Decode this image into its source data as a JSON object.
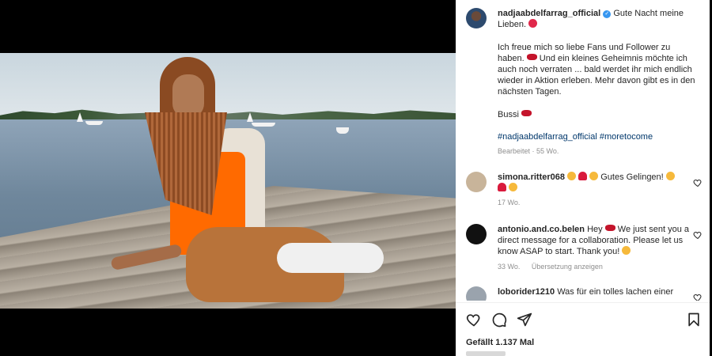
{
  "post": {
    "username": "nadjaabdelfarrag_official",
    "caption_line1": "Gute Nacht meine Lieben.",
    "caption_para2": "Ich freue mich so liebe Fans und Follower zu haben.",
    "caption_para2b": "Und ein kleines Geheimnis möchte ich auch noch verraten ... bald werdet ihr mich endlich wieder in Aktion erleben. Mehr davon gibt es in den nächsten Tagen.",
    "caption_bussi": "Bussi",
    "hashtags": "#nadjaabdelfarrag_official #moretocome",
    "edited": "Bearbeitet",
    "age": "55 Wo."
  },
  "comments": [
    {
      "username": "simona.ritter068",
      "text": "Gutes Gelingen!",
      "age": "17 Wo.",
      "avatar_color": "#c8b49a"
    },
    {
      "username": "antonio.and.co.belen",
      "text_a": "Hey",
      "text_b": "We just sent you a direct message for a collaboration. Please let us know ASAP to start. Thank you!",
      "age": "33 Wo.",
      "translate": "Übersetzung anzeigen",
      "avatar_color": "#111111"
    },
    {
      "username": "loborider1210",
      "text": "Was für ein tolles lachen einer",
      "avatar_color": "#9aa3ad"
    }
  ],
  "footer": {
    "likes": "Gefällt 1.137 Mal"
  },
  "icons": {
    "like": "heart-icon",
    "comment": "comment-icon",
    "share": "paper-plane-icon",
    "save": "bookmark-icon"
  },
  "colors": {
    "link": "#00376b",
    "meta": "#8e8e8e",
    "text": "#262626",
    "verified": "#3897f0"
  }
}
